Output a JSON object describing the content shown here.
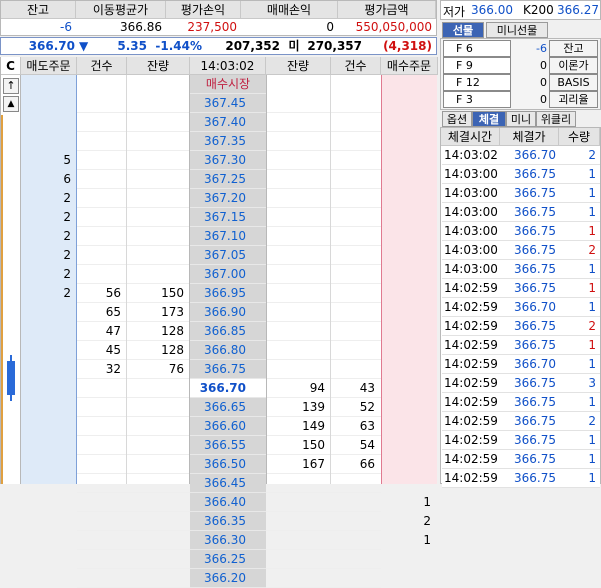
{
  "summary": {
    "headers": [
      "잔고",
      "이동평균가",
      "평가손익",
      "매매손익",
      "평가금액"
    ],
    "values": [
      "-6",
      "366.86",
      "237,500",
      "0",
      "550,050,000"
    ]
  },
  "quote": {
    "price": "366.70",
    "arrow": "▼",
    "change": "5.35",
    "change_pct": "-1.44%",
    "volume_a": "207,352",
    "mid_label": "미",
    "volume_b": "270,357",
    "diff": "(4,318)"
  },
  "book": {
    "corner": "C",
    "up_arrow": "↑",
    "down_arrow": "▲",
    "headers": [
      "매도주문",
      "건수",
      "잔량",
      "14:03:02",
      "잔량",
      "건수",
      "매수주문"
    ],
    "market_label": "매수시장",
    "prices": [
      "367.45",
      "367.40",
      "367.35",
      "367.30",
      "367.25",
      "367.20",
      "367.15",
      "367.10",
      "367.05",
      "367.00",
      "366.95",
      "366.90",
      "366.85",
      "366.80",
      "366.75",
      "366.70",
      "366.65",
      "366.60",
      "366.55",
      "366.50",
      "366.45",
      "366.40",
      "366.35",
      "366.30",
      "366.25",
      "366.20"
    ],
    "sell_orders": {
      "3": "5",
      "4": "6",
      "5": "2",
      "6": "2",
      "7": "2",
      "8": "2",
      "9": "2",
      "10": "2"
    },
    "ask_counts": {
      "10": "56",
      "11": "65",
      "12": "47",
      "13": "45",
      "14": "32"
    },
    "ask_qty": {
      "10": "150",
      "11": "173",
      "12": "128",
      "13": "128",
      "14": "76"
    },
    "bid_qty": {
      "15": "94",
      "16": "139",
      "17": "149",
      "18": "150",
      "19": "167"
    },
    "bid_counts": {
      "15": "43",
      "16": "52",
      "17": "63",
      "18": "54",
      "19": "66"
    },
    "buy_orders": {
      "21": "1",
      "22": "2",
      "23": "1"
    },
    "current_price_index": 15
  },
  "right": {
    "low_label": "저가",
    "low_value": "366.00",
    "k200_label": "K200",
    "k200_value": "366.27",
    "product_tabs": [
      "선물",
      "미니선물"
    ],
    "fkeys": [
      {
        "key": "F 6",
        "value": "-6",
        "button": "잔고"
      },
      {
        "key": "F 9",
        "value": "0",
        "button": "이론가"
      },
      {
        "key": "F 12",
        "value": "0",
        "button": "BASIS"
      },
      {
        "key": "F 3",
        "value": "0",
        "button": "괴리율"
      }
    ],
    "lower_tabs": [
      "옵션",
      "체결",
      "미니",
      "위클리"
    ],
    "trade_headers": [
      "체결시간",
      "체결가",
      "수량"
    ],
    "trades": [
      {
        "time": "14:03:02",
        "price": "366.70",
        "qty": "2",
        "side": "sell"
      },
      {
        "time": "14:03:00",
        "price": "366.75",
        "qty": "1",
        "side": "sell"
      },
      {
        "time": "14:03:00",
        "price": "366.75",
        "qty": "1",
        "side": "sell"
      },
      {
        "time": "14:03:00",
        "price": "366.75",
        "qty": "1",
        "side": "sell"
      },
      {
        "time": "14:03:00",
        "price": "366.75",
        "qty": "1",
        "side": "buy"
      },
      {
        "time": "14:03:00",
        "price": "366.75",
        "qty": "2",
        "side": "buy"
      },
      {
        "time": "14:03:00",
        "price": "366.75",
        "qty": "1",
        "side": "sell"
      },
      {
        "time": "14:02:59",
        "price": "366.75",
        "qty": "1",
        "side": "buy"
      },
      {
        "time": "14:02:59",
        "price": "366.70",
        "qty": "1",
        "side": "sell"
      },
      {
        "time": "14:02:59",
        "price": "366.75",
        "qty": "2",
        "side": "buy"
      },
      {
        "time": "14:02:59",
        "price": "366.75",
        "qty": "1",
        "side": "buy"
      },
      {
        "time": "14:02:59",
        "price": "366.70",
        "qty": "1",
        "side": "sell"
      },
      {
        "time": "14:02:59",
        "price": "366.75",
        "qty": "3",
        "side": "sell"
      },
      {
        "time": "14:02:59",
        "price": "366.75",
        "qty": "1",
        "side": "sell"
      },
      {
        "time": "14:02:59",
        "price": "366.75",
        "qty": "2",
        "side": "sell"
      },
      {
        "time": "14:02:59",
        "price": "366.75",
        "qty": "1",
        "side": "sell"
      },
      {
        "time": "14:02:59",
        "price": "366.75",
        "qty": "1",
        "side": "sell"
      },
      {
        "time": "14:02:59",
        "price": "366.75",
        "qty": "1",
        "side": "sell"
      }
    ]
  },
  "colors": {
    "buy": "#d01010",
    "sell": "#1050c8",
    "accent": "#3c64b4"
  }
}
